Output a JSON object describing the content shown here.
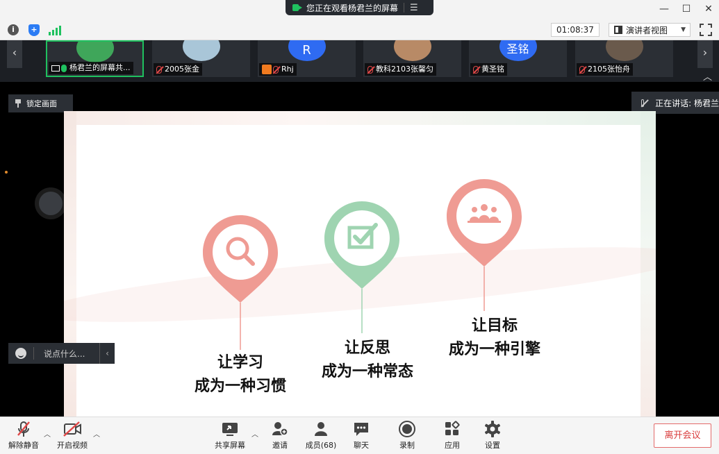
{
  "titlebar": {
    "share_notice": "您正在观看杨君兰的屏幕",
    "menu_glyph": "☰",
    "window_controls": [
      "—",
      "☐",
      "✕"
    ]
  },
  "status": {
    "info_glyph": "i",
    "shield_glyph": "+",
    "timer": "01:08:37",
    "view_mode": "演讲者视图",
    "view_caret": "▼"
  },
  "participants": {
    "prev_arrow": "‹",
    "next_arrow": "›",
    "collapse_glyph": "︿",
    "tiles": [
      {
        "name": "杨君兰的屏幕共...",
        "avatar_letter": "",
        "avatar_color": "#3fa65a"
      },
      {
        "name": "2005张金",
        "avatar_letter": "",
        "avatar_color": "#a9c6d8"
      },
      {
        "name": "Rhj",
        "avatar_letter": "R",
        "avatar_color": "#2f6bf2"
      },
      {
        "name": "教科2103张馨匀",
        "avatar_letter": "",
        "avatar_color": "#b88a66"
      },
      {
        "name": "黄圣铭",
        "avatar_letter": "圣铭",
        "avatar_color": "#2f6bf2"
      },
      {
        "name": "2105张怡舟",
        "avatar_letter": "",
        "avatar_color": "#6a5a4c"
      }
    ]
  },
  "lock_view": "锁定画面",
  "speaking": "正在讲话: 杨君兰",
  "slide": {
    "items": [
      {
        "line1": "让学习",
        "line2": "成为一种习惯",
        "color": "#ef9b93",
        "icon": "search-icon"
      },
      {
        "line1": "让反思",
        "line2": "成为一种常态",
        "color": "#9fd4b1",
        "icon": "checkbox-icon"
      },
      {
        "line1": "让目标",
        "line2": "成为一种引擎",
        "color": "#ef9b93",
        "icon": "group-icon"
      }
    ]
  },
  "chat": {
    "placeholder": "说点什么...",
    "chevron": "‹"
  },
  "toolbar": {
    "unmute": "解除静音",
    "start_video": "开启视频",
    "share_screen": "共享屏幕",
    "invite": "邀请",
    "members": "成员(68)",
    "chat": "聊天",
    "record": "录制",
    "apps": "应用",
    "settings": "设置",
    "leave": "离开会议",
    "caret": "︿"
  },
  "colors": {
    "accent_green": "#1fc15f",
    "muted_red": "#e04848",
    "leave_red": "#d93d3d",
    "pin_pink": "#ef9b93",
    "pin_green": "#9fd4b1"
  }
}
